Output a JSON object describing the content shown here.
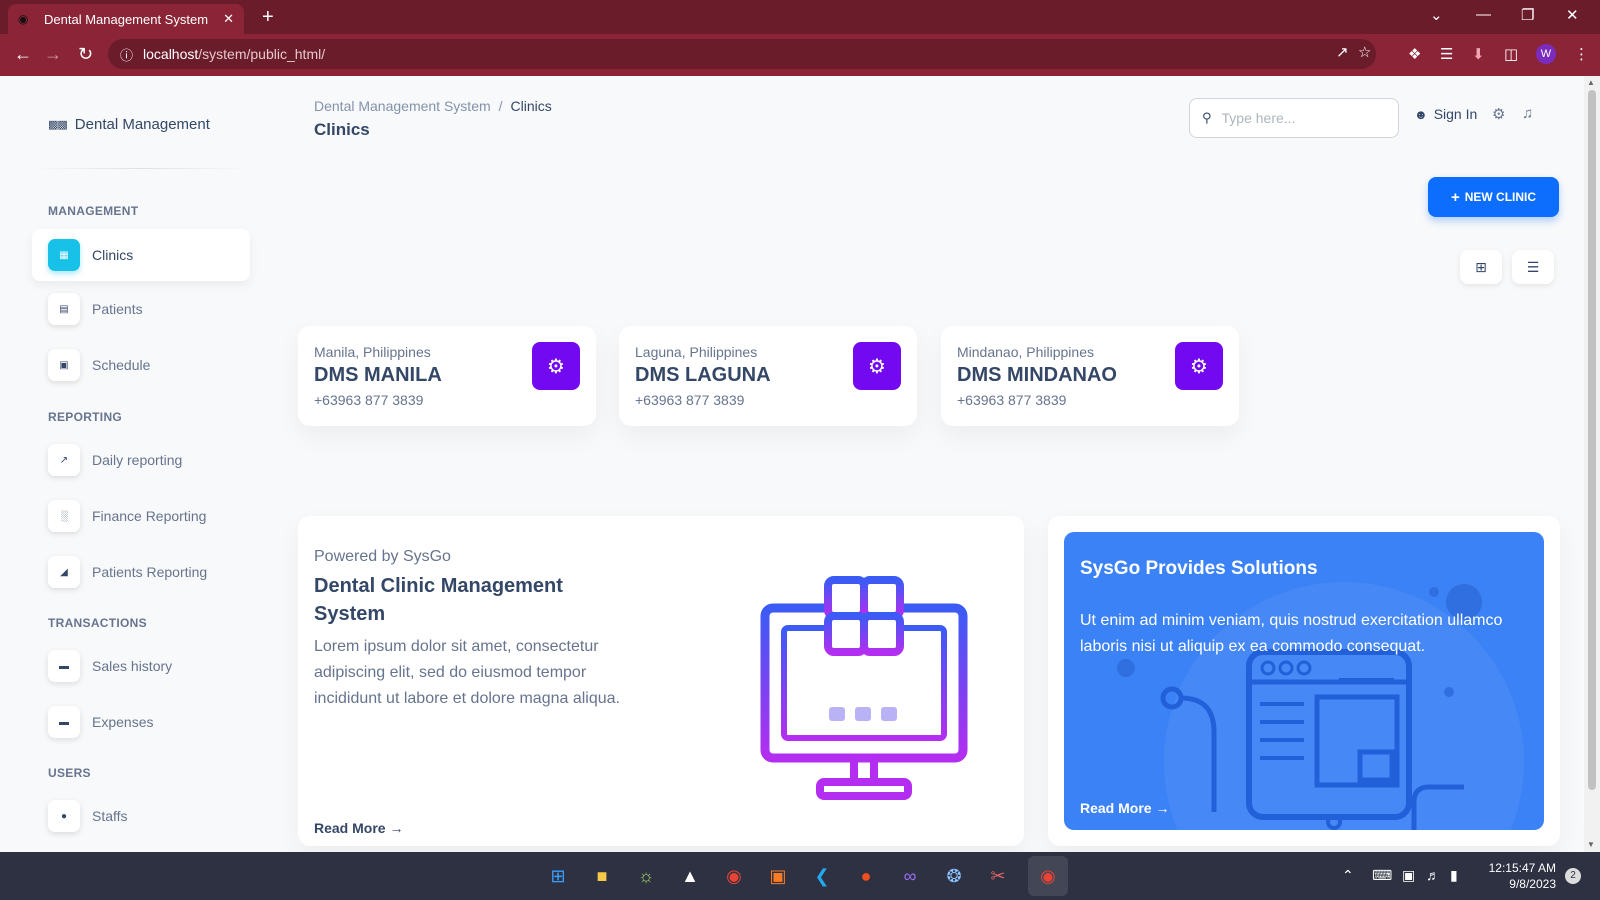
{
  "browser": {
    "tab_title": "Dental Management System",
    "url_host": "localhost",
    "url_path": "/system/public_html/",
    "profile_initial": "W"
  },
  "sidebar": {
    "brand": "Dental Management",
    "sections": [
      {
        "title": "MANAGEMENT"
      },
      {
        "title": "REPORTING"
      },
      {
        "title": "TRANSACTIONS"
      },
      {
        "title": "USERS"
      }
    ],
    "items": [
      {
        "label": "Clinics",
        "icon": "building-icon",
        "active": true
      },
      {
        "label": "Patients",
        "icon": "document-icon"
      },
      {
        "label": "Schedule",
        "icon": "calendar-icon"
      },
      {
        "label": "Daily reporting",
        "icon": "line-chart-icon"
      },
      {
        "label": "Finance Reporting",
        "icon": "bar-chart-icon"
      },
      {
        "label": "Patients Reporting",
        "icon": "area-chart-icon"
      },
      {
        "label": "Sales history",
        "icon": "money-icon"
      },
      {
        "label": "Expenses",
        "icon": "money-icon"
      },
      {
        "label": "Staffs",
        "icon": "user-icon"
      }
    ]
  },
  "header": {
    "breadcrumb_root": "Dental Management System",
    "breadcrumb_current": "Clinics",
    "title": "Clinics",
    "search_placeholder": "Type here...",
    "signin_label": "Sign In"
  },
  "actions": {
    "new_clinic": "NEW CLINIC"
  },
  "clinics": [
    {
      "location": "Manila, Philippines",
      "name": "DMS MANILA",
      "phone": "+63963 877 3839"
    },
    {
      "location": "Laguna, Philippines",
      "name": "DMS LAGUNA",
      "phone": "+63963 877 3839"
    },
    {
      "location": "Mindanao, Philippines",
      "name": "DMS MINDANAO",
      "phone": "+63963 877 3839"
    }
  ],
  "info_card": {
    "powered": "Powered by SysGo",
    "title": "Dental Clinic Management System",
    "description": "Lorem ipsum dolor sit amet, consectetur adipiscing elit, sed do eiusmod tempor incididunt ut labore et dolore magna aliqua.",
    "read_more": "Read More"
  },
  "solutions_card": {
    "title": "SysGo Provides Solutions",
    "description": "Ut enim ad minim veniam, quis nostrud exercitation ullamco laboris nisi ut aliquip ex ea commodo consequat.",
    "read_more": "Read More"
  },
  "taskbar": {
    "time": "12:15:47 AM",
    "date": "9/8/2023",
    "notification_count": "2"
  },
  "colors": {
    "accent": "#0d6efd",
    "gear_button": "#7209f0",
    "active_icon": "#17c1e8",
    "solutions_bg": "#3b82f6",
    "browser_frame": "#8a2436"
  }
}
